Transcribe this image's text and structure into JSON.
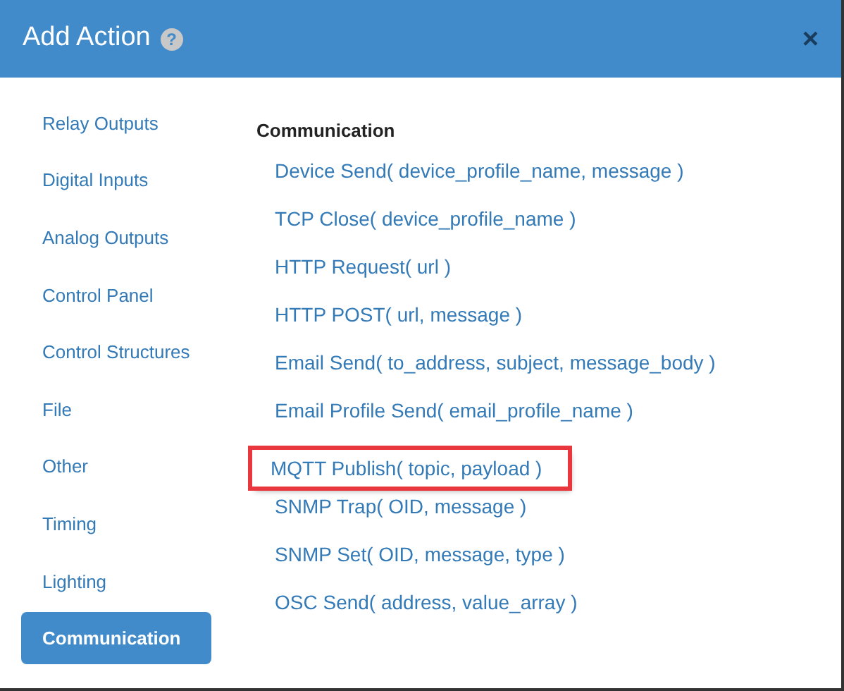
{
  "modal": {
    "title": "Add Action",
    "help": "?",
    "close": "×"
  },
  "categories": [
    {
      "label": "Relay Outputs",
      "selected": false
    },
    {
      "label": "Digital Inputs",
      "selected": false
    },
    {
      "label": "Analog Outputs",
      "selected": false
    },
    {
      "label": "Control Panel",
      "selected": false
    },
    {
      "label": "Control Structures",
      "selected": false
    },
    {
      "label": "File",
      "selected": false
    },
    {
      "label": "Other",
      "selected": false
    },
    {
      "label": "Timing",
      "selected": false
    },
    {
      "label": "Lighting",
      "selected": false
    },
    {
      "label": "Communication",
      "selected": true
    }
  ],
  "section": {
    "heading": "Communication",
    "actions": [
      {
        "label": "Device Send( device_profile_name, message )",
        "highlighted": false
      },
      {
        "label": "TCP Close( device_profile_name )",
        "highlighted": false
      },
      {
        "label": "HTTP Request( url )",
        "highlighted": false
      },
      {
        "label": "HTTP POST( url, message )",
        "highlighted": false
      },
      {
        "label": "Email Send( to_address, subject, message_body )",
        "highlighted": false
      },
      {
        "label": "Email Profile Send( email_profile_name )",
        "highlighted": false
      },
      {
        "label": "MQTT Publish( topic, payload )",
        "highlighted": true
      },
      {
        "label": "SNMP Trap( OID, message )",
        "highlighted": false
      },
      {
        "label": "SNMP Set( OID, message, type )",
        "highlighted": false
      },
      {
        "label": "OSC Send( address, value_array )",
        "highlighted": false
      }
    ]
  }
}
